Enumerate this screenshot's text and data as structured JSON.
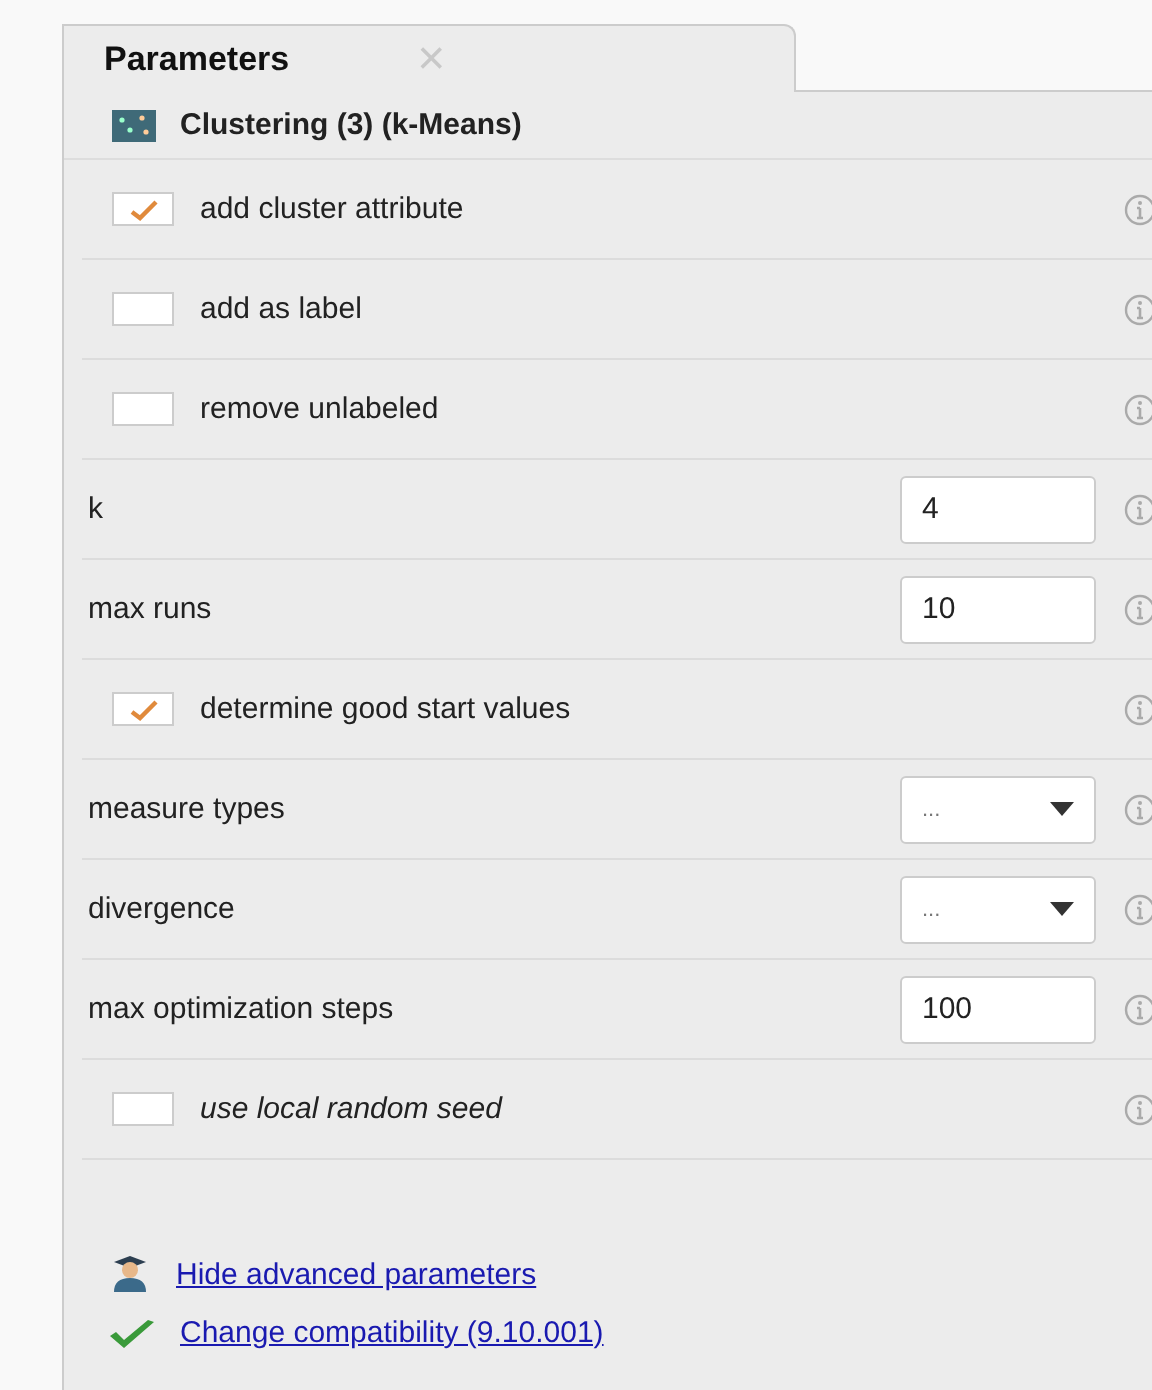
{
  "tab": {
    "label": "Parameters",
    "close": "×"
  },
  "operator": {
    "title": "Clustering (3) (k-Means)"
  },
  "parameters": [
    {
      "kind": "checkbox",
      "label": "add cluster attribute",
      "checked": true,
      "italic": false
    },
    {
      "kind": "checkbox",
      "label": "add as label",
      "checked": false,
      "italic": false
    },
    {
      "kind": "checkbox",
      "label": "remove unlabeled",
      "checked": false,
      "italic": false
    },
    {
      "kind": "number",
      "label": "k",
      "value": "4",
      "italic": false
    },
    {
      "kind": "number",
      "label": "max runs",
      "value": "10",
      "italic": false
    },
    {
      "kind": "checkbox",
      "label": "determine good start values",
      "checked": true,
      "italic": false
    },
    {
      "kind": "select",
      "label": "measure types",
      "value": "...",
      "italic": false
    },
    {
      "kind": "select",
      "label": "divergence",
      "value": "...",
      "italic": false
    },
    {
      "kind": "number",
      "label": "max optimization steps",
      "value": "100",
      "italic": false
    },
    {
      "kind": "checkbox",
      "label": "use local random seed",
      "checked": false,
      "italic": true
    }
  ],
  "links": [
    {
      "kind": "advanced",
      "label": "Hide advanced parameters"
    },
    {
      "kind": "compatibility",
      "label": "Change compatibility (9.10.001)"
    }
  ]
}
